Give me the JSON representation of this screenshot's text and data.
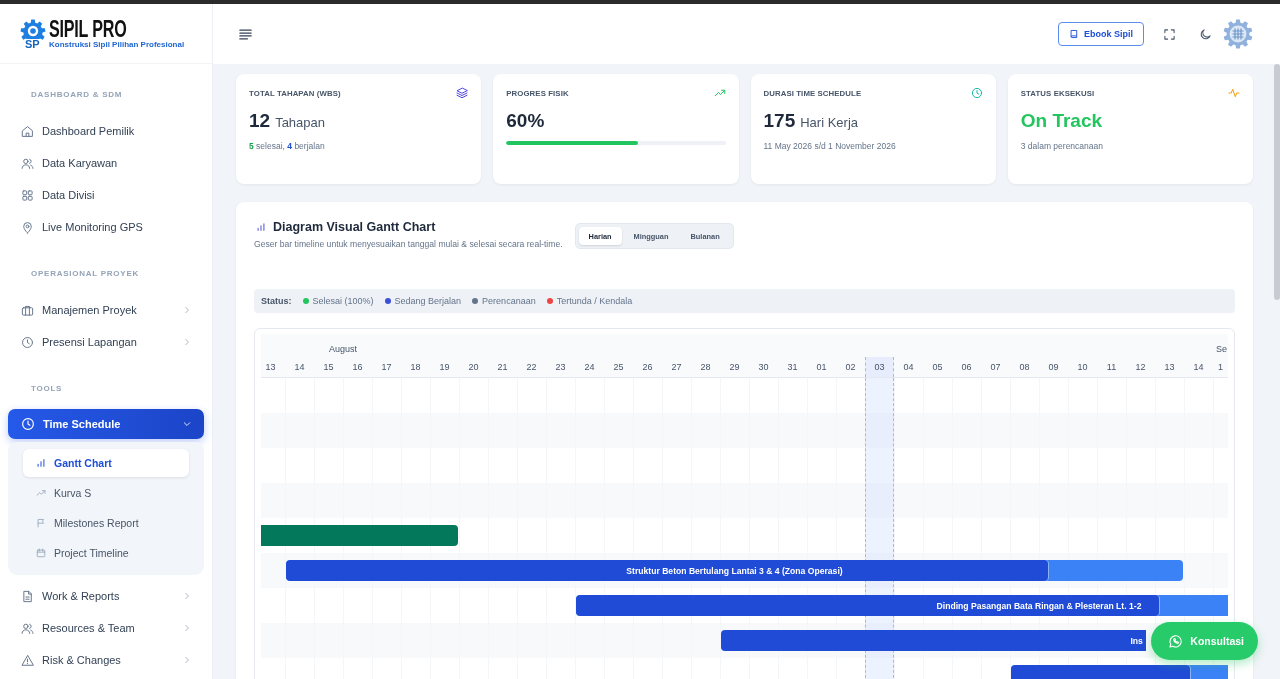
{
  "logo": {
    "monogram": "SP",
    "name": "SIPIL PRO",
    "tagline": "Konstruksi Sipil Pilihan Profesional"
  },
  "sidebar": {
    "sections": [
      {
        "title": "DASHBOARD & SDM",
        "items": [
          {
            "label": "Dashboard Pemilik",
            "kind": "link",
            "selected": false
          },
          {
            "label": "Data Karyawan",
            "kind": "link",
            "selected": false
          },
          {
            "label": "Data Divisi",
            "kind": "link",
            "selected": false
          },
          {
            "label": "Live Monitoring GPS",
            "kind": "link",
            "selected": false
          }
        ]
      },
      {
        "title": "OPERASIONAL PROYEK",
        "items": [
          {
            "label": "Manajemen Proyek",
            "kind": "group",
            "selected": false,
            "expanded": false
          },
          {
            "label": "Presensi Lapangan",
            "kind": "group",
            "selected": false,
            "expanded": false
          }
        ]
      },
      {
        "title": "TOOLS",
        "items": [
          {
            "label": "Time Schedule",
            "kind": "group",
            "selected": true,
            "expanded": true,
            "children": [
              {
                "label": "Gantt Chart",
                "selected": true
              },
              {
                "label": "Kurva S",
                "selected": false
              },
              {
                "label": "Milestones Report",
                "selected": false
              },
              {
                "label": "Project Timeline",
                "selected": false
              }
            ]
          },
          {
            "label": "Work & Reports",
            "kind": "group",
            "selected": false,
            "expanded": false
          },
          {
            "label": "Resources & Team",
            "kind": "group",
            "selected": false,
            "expanded": false
          },
          {
            "label": "Risk & Changes",
            "kind": "group",
            "selected": false,
            "expanded": false
          }
        ]
      }
    ]
  },
  "header": {
    "ebook_button": "Ebook Sipil"
  },
  "stats": [
    {
      "kind": "count",
      "label": "TOTAL TAHAPAN (WBS)",
      "value": "12",
      "unit": "Tahapan",
      "summary": [
        {
          "count": "5",
          "text": "selesai,",
          "kind": "done"
        },
        {
          "count": "4",
          "text": "berjalan",
          "kind": "running"
        }
      ]
    },
    {
      "kind": "progress",
      "label": "PROGRES FISIK",
      "value": "60%",
      "level": 0.6
    },
    {
      "kind": "count",
      "label": "DURASI TIME SCHEDULE",
      "value": "175",
      "unit": "Hari Kerja",
      "note": "11 May 2026 s/d 1 November 2026"
    },
    {
      "kind": "status",
      "label": "STATUS EKSEKUSI",
      "value": "On Track",
      "note": "3 dalam perencanaan"
    }
  ],
  "gantt": {
    "title": "Diagram Visual Gantt Chart",
    "subtitle": "Geser bar timeline untuk menyesuaikan tanggal mulai & selesai secara real-time.",
    "views": [
      {
        "label": "Harian",
        "selected": true
      },
      {
        "label": "Mingguan",
        "selected": false
      },
      {
        "label": "Bulanan",
        "selected": false
      }
    ],
    "legend": {
      "label": "Status:",
      "items": [
        {
          "label": "Selesai (100%)",
          "color": "#22c55e"
        },
        {
          "label": "Sedang Berjalan",
          "color": "#3b4fd8"
        },
        {
          "label": "Perencanaan",
          "color": "#64748b"
        },
        {
          "label": "Tertunda / Kendala",
          "color": "#ef4444"
        }
      ]
    },
    "months": [
      {
        "label": "August"
      },
      {
        "label": "Se"
      }
    ],
    "days": [
      {
        "label": "13",
        "today": false
      },
      {
        "label": "14",
        "today": false
      },
      {
        "label": "15",
        "today": false
      },
      {
        "label": "16",
        "today": false
      },
      {
        "label": "17",
        "today": false
      },
      {
        "label": "18",
        "today": false
      },
      {
        "label": "19",
        "today": false
      },
      {
        "label": "20",
        "today": false
      },
      {
        "label": "21",
        "today": false
      },
      {
        "label": "22",
        "today": false
      },
      {
        "label": "23",
        "today": false
      },
      {
        "label": "24",
        "today": false
      },
      {
        "label": "25",
        "today": false
      },
      {
        "label": "26",
        "today": false
      },
      {
        "label": "27",
        "today": false
      },
      {
        "label": "28",
        "today": false
      },
      {
        "label": "29",
        "today": false
      },
      {
        "label": "30",
        "today": false
      },
      {
        "label": "31",
        "today": false
      },
      {
        "label": "01",
        "today": false
      },
      {
        "label": "02",
        "today": false
      },
      {
        "label": "03",
        "today": true
      },
      {
        "label": "04",
        "today": false
      },
      {
        "label": "05",
        "today": false
      },
      {
        "label": "06",
        "today": false
      },
      {
        "label": "07",
        "today": false
      },
      {
        "label": "08",
        "today": false
      },
      {
        "label": "09",
        "today": false
      },
      {
        "label": "10",
        "today": false
      },
      {
        "label": "11",
        "today": false
      },
      {
        "label": "12",
        "today": false
      },
      {
        "label": "13",
        "today": false
      },
      {
        "label": "14",
        "today": false
      },
      {
        "label": "1",
        "today": false
      }
    ],
    "rows": [
      {
        "kind": "empty"
      },
      {
        "kind": "empty"
      },
      {
        "kind": "empty"
      },
      {
        "kind": "empty"
      },
      {
        "kind": "done"
      },
      {
        "kind": "running",
        "level": 0.85,
        "label": "Struktur Beton Bertulang Lantai 3 & 4 (Zona Operasi)"
      },
      {
        "kind": "running",
        "level": 0.63,
        "label": "Dinding Pasangan Bata Ringan & Plesteran Lt. 1-2"
      },
      {
        "kind": "running",
        "label": "Ins"
      },
      {
        "kind": "running",
        "level": 0.62
      }
    ]
  },
  "floating_button": {
    "label": "Konsultasi"
  }
}
